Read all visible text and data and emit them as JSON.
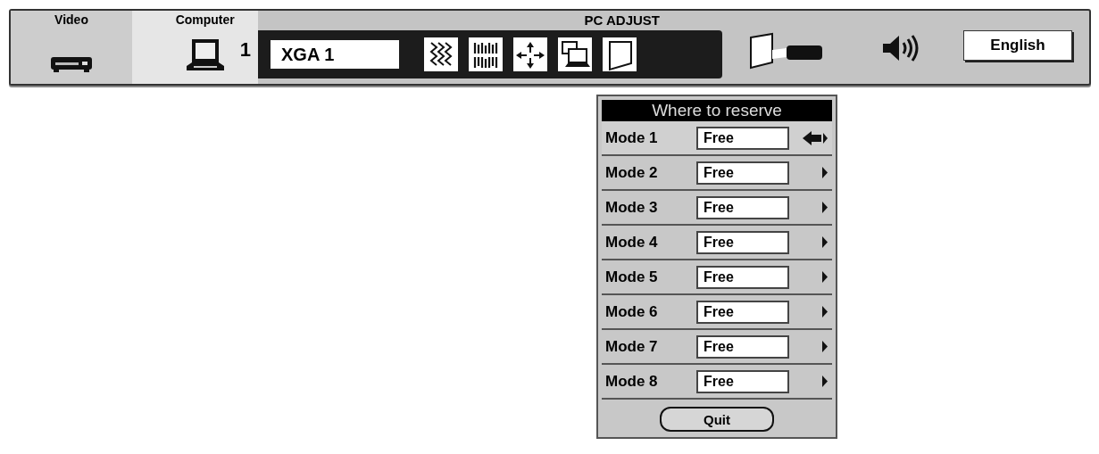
{
  "top_bar": {
    "tabs": [
      {
        "label": "Video",
        "kind": "video",
        "selected": false
      },
      {
        "label": "Computer",
        "kind": "computer",
        "selected": true,
        "badge": "1"
      }
    ],
    "panel": {
      "title": "PC ADJUST",
      "field": {
        "value": "XGA 1"
      },
      "tools": [
        {
          "kind": "waves"
        },
        {
          "kind": "bars"
        },
        {
          "kind": "move"
        },
        {
          "kind": "windows"
        },
        {
          "kind": "page"
        }
      ]
    },
    "language": "English"
  },
  "dialog": {
    "title": "Where to reserve",
    "modes": [
      {
        "label": "Mode 1",
        "value": "Free",
        "selected": true
      },
      {
        "label": "Mode 2",
        "value": "Free",
        "selected": false
      },
      {
        "label": "Mode 3",
        "value": "Free",
        "selected": false
      },
      {
        "label": "Mode 4",
        "value": "Free",
        "selected": false
      },
      {
        "label": "Mode 5",
        "value": "Free",
        "selected": false
      },
      {
        "label": "Mode 6",
        "value": "Free",
        "selected": false
      },
      {
        "label": "Mode 7",
        "value": "Free",
        "selected": false
      },
      {
        "label": "Mode 8",
        "value": "Free",
        "selected": false
      }
    ],
    "quit": "Quit"
  }
}
